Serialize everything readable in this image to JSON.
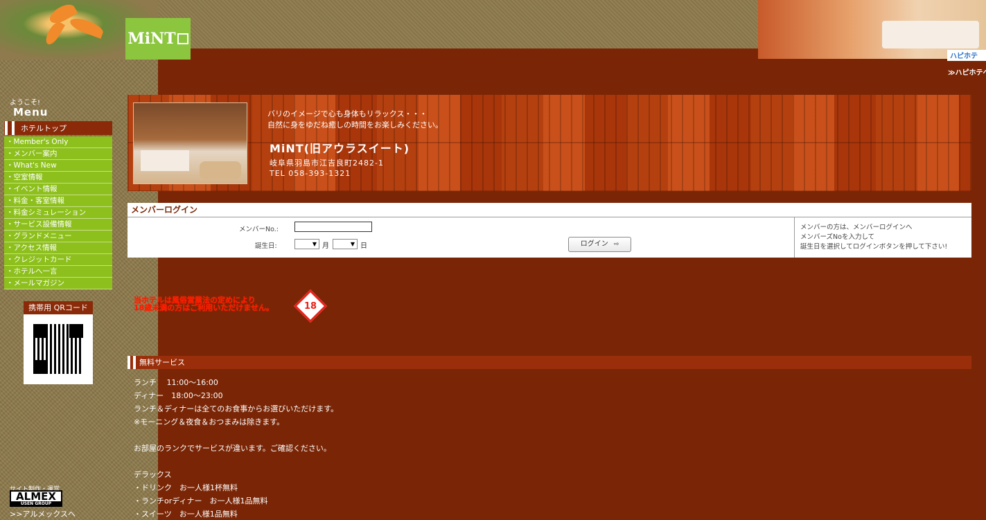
{
  "header": {
    "logo_text": "MiNT",
    "happy_link": "ハピホテ",
    "happy_link2": "≫ハピホテへ"
  },
  "sidebar": {
    "welcome": "ようこそ!",
    "menu_title": "Menu",
    "hotel_top": "ホテルトップ",
    "items": [
      {
        "label": "Member's Only"
      },
      {
        "label": "メンバー案内"
      },
      {
        "label": "What's New"
      },
      {
        "label": "空室情報"
      },
      {
        "label": "イベント情報"
      },
      {
        "label": "料金・客室情報"
      },
      {
        "label": "料金シミュレーション"
      },
      {
        "label": "サービス設備情報"
      },
      {
        "label": "グランドメニュー"
      },
      {
        "label": "アクセス情報"
      },
      {
        "label": "クレジットカード"
      },
      {
        "label": "ホテルへ一言"
      },
      {
        "label": "メールマガジン"
      }
    ],
    "qr_title": "携帯用 QRコード",
    "producer": "サイト制作・運営",
    "almex_logo": "ALMEX",
    "almex_sub": "USEN GROUP",
    "almex_link": ">>アルメックスへ"
  },
  "banner": {
    "tagline1": "バリのイメージで心も身体もリラックス・・・",
    "tagline2": "自然に身をゆだね癒しの時間をお楽しみください。",
    "hotel_name": "MiNT(旧アウラスイート)",
    "address": "岐阜県羽島市江吉良町2482-1",
    "tel": "TEL 058-393-1321"
  },
  "login": {
    "title": "メンバーログイン",
    "member_no_label": "メンバーNo.:",
    "member_no_value": "",
    "birthday_label": "誕生日:",
    "month_unit": "月",
    "day_unit": "日",
    "select_arrow": "▼",
    "button_label": "ログイン",
    "button_arrow": "⇨",
    "help1": "メンバーの方は、メンバーログインへ",
    "help2": "メンバーズNoを入力して",
    "help3": "誕生日を選択してログインボタンを押して下さい!"
  },
  "notice": {
    "line1": "当ホテルは風俗営業法の定めにより",
    "line2": "18歳未満の方はご利用いただけません。",
    "badge": "18"
  },
  "service": {
    "title": "無料サービス",
    "lines": [
      "ランチ　 11:00～16:00",
      "ディナー　18:00～23:00",
      "ランチ＆ディナーは全てのお食事からお選びいただけます。",
      "※モーニング＆夜食＆おつまみは除きます。",
      "",
      "お部屋のランクでサービスが違います。ご確認ください。",
      "",
      "デラックス",
      "・ドリンク　お一人様1杯無料",
      "・ランチorディナー　お一人様1品無料",
      "・スイーツ　お一人様1品無料"
    ]
  },
  "colors": {
    "background": "#7a2606",
    "menu_green": "#8dc01c",
    "header_brown": "#8a2a08",
    "notice_red": "#ff1a00"
  }
}
